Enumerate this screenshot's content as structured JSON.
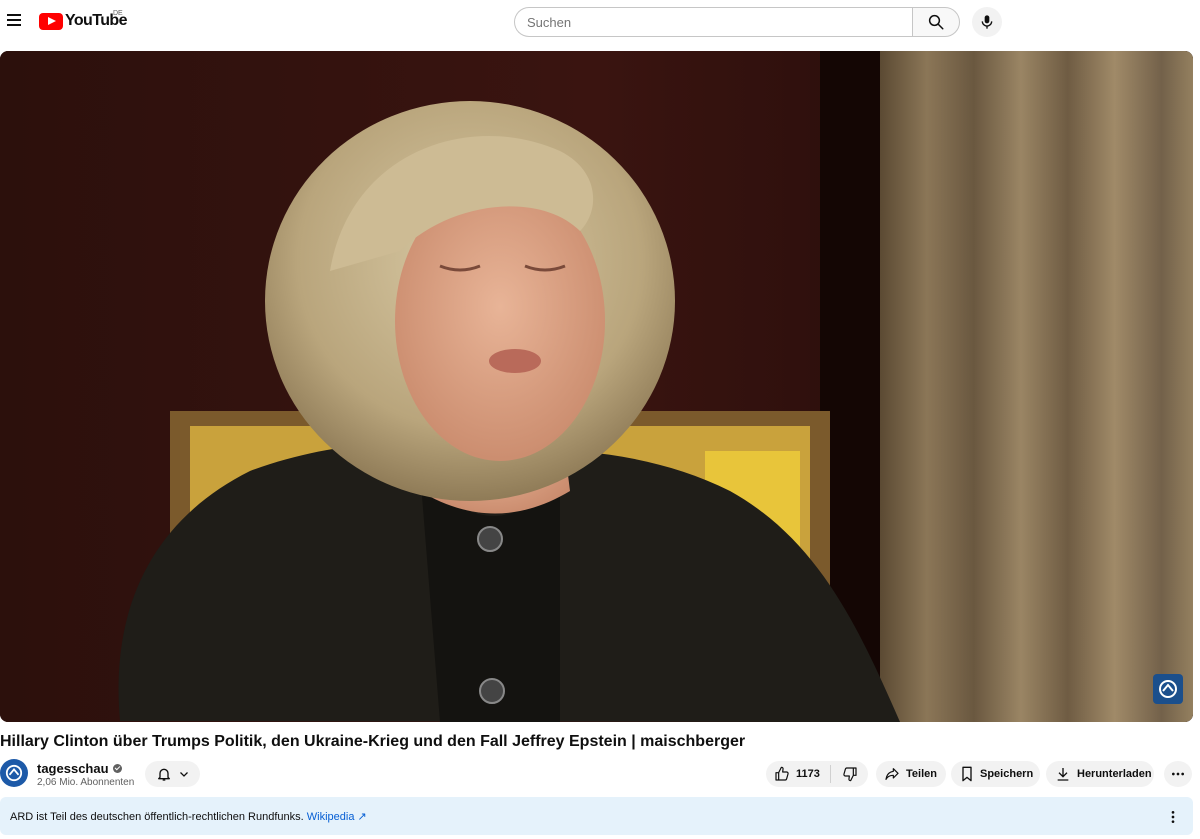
{
  "header": {
    "logo_text": "YouTube",
    "region": "DE",
    "search_placeholder": "Suchen"
  },
  "video": {
    "title": "Hillary Clinton über Trumps Politik, den Ukraine-Krieg und den Fall Jeffrey Epstein | maischberger"
  },
  "channel": {
    "name": "tagesschau",
    "subscribers": "2,06 Mio. Abonnenten"
  },
  "actions": {
    "likes": "1173",
    "share": "Teilen",
    "save": "Speichern",
    "download": "Herunterladen"
  },
  "info_panel": {
    "text": "ARD ist Teil des deutschen öffentlich-rechtlichen Rundfunks. ",
    "link": "Wikipedia ↗"
  },
  "colors": {
    "brand_red": "#ff0000",
    "info_bg": "#e5f2fb",
    "link": "#065fd4"
  }
}
